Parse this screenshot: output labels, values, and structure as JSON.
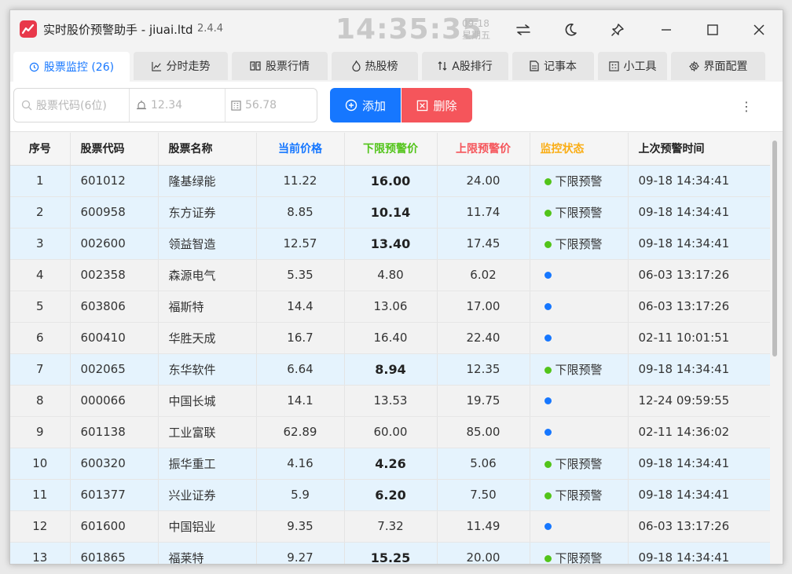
{
  "app": {
    "title": "实时股价预警助手 - jiuai.ltd",
    "version": "2.4.4",
    "clock": "14:35:35",
    "date": "09-18",
    "weekday": "星期五"
  },
  "tabs": [
    {
      "label": "股票监控 (26)",
      "icon": "clock-icon",
      "active": true
    },
    {
      "label": "分时走势",
      "icon": "line-chart-icon"
    },
    {
      "label": "股票行情",
      "icon": "book-icon"
    },
    {
      "label": "热股榜",
      "icon": "fire-icon"
    },
    {
      "label": "A股排行",
      "icon": "sort-icon"
    },
    {
      "label": "记事本",
      "icon": "note-icon"
    },
    {
      "label": "小工具",
      "icon": "tools-icon"
    },
    {
      "label": "界面配置",
      "icon": "gear-icon"
    }
  ],
  "toolbar": {
    "code_placeholder": "股票代码(6位)",
    "low_placeholder": "12.34",
    "high_placeholder": "56.78",
    "add_label": "添加",
    "delete_label": "删除"
  },
  "table": {
    "headers": {
      "index": "序号",
      "code": "股票代码",
      "name": "股票名称",
      "price": "当前价格",
      "low": "下限预警价",
      "high": "上限预警价",
      "status": "监控状态",
      "last_time": "上次预警时间"
    },
    "rows": [
      {
        "index": "1",
        "code": "601012",
        "name": "隆基绿能",
        "price": "11.22",
        "low": "16.00",
        "high": "24.00",
        "status": "下限预警",
        "time": "09-18 14:34:41"
      },
      {
        "index": "2",
        "code": "600958",
        "name": "东方证券",
        "price": "8.85",
        "low": "10.14",
        "high": "11.74",
        "status": "下限预警",
        "time": "09-18 14:34:41"
      },
      {
        "index": "3",
        "code": "002600",
        "name": "领益智造",
        "price": "12.57",
        "low": "13.40",
        "high": "17.45",
        "status": "下限预警",
        "time": "09-18 14:34:41"
      },
      {
        "index": "4",
        "code": "002358",
        "name": "森源电气",
        "price": "5.35",
        "low": "4.80",
        "high": "6.02",
        "status": "",
        "time": "06-03 13:17:26"
      },
      {
        "index": "5",
        "code": "603806",
        "name": "福斯特",
        "price": "14.4",
        "low": "13.06",
        "high": "17.00",
        "status": "",
        "time": "06-03 13:17:26"
      },
      {
        "index": "6",
        "code": "600410",
        "name": "华胜天成",
        "price": "16.7",
        "low": "16.40",
        "high": "22.40",
        "status": "",
        "time": "02-11 10:01:51"
      },
      {
        "index": "7",
        "code": "002065",
        "name": "东华软件",
        "price": "6.64",
        "low": "8.94",
        "high": "12.35",
        "status": "下限预警",
        "time": "09-18 14:34:41"
      },
      {
        "index": "8",
        "code": "000066",
        "name": "中国长城",
        "price": "14.1",
        "low": "13.53",
        "high": "19.75",
        "status": "",
        "time": "12-24 09:59:55"
      },
      {
        "index": "9",
        "code": "601138",
        "name": "工业富联",
        "price": "62.89",
        "low": "60.00",
        "high": "85.00",
        "status": "",
        "time": "02-11 14:36:02"
      },
      {
        "index": "10",
        "code": "600320",
        "name": "振华重工",
        "price": "4.16",
        "low": "4.26",
        "high": "5.06",
        "status": "下限预警",
        "time": "09-18 14:34:41"
      },
      {
        "index": "11",
        "code": "601377",
        "name": "兴业证券",
        "price": "5.9",
        "low": "6.20",
        "high": "7.50",
        "status": "下限预警",
        "time": "09-18 14:34:41"
      },
      {
        "index": "12",
        "code": "601600",
        "name": "中国铝业",
        "price": "9.35",
        "low": "7.32",
        "high": "11.49",
        "status": "",
        "time": "06-03 13:17:26"
      },
      {
        "index": "13",
        "code": "601865",
        "name": "福莱特",
        "price": "9.27",
        "low": "15.25",
        "high": "20.00",
        "status": "下限预警",
        "time": "09-18 14:34:41"
      }
    ]
  },
  "colors": {
    "accent": "#1677ff",
    "danger": "#f5555b",
    "price_header": "#1677ff",
    "low_header": "#52c41a",
    "high_header": "#f5555b",
    "status_header": "#faad14",
    "alert_dot": "#52c41a",
    "idle_dot": "#1677ff"
  }
}
